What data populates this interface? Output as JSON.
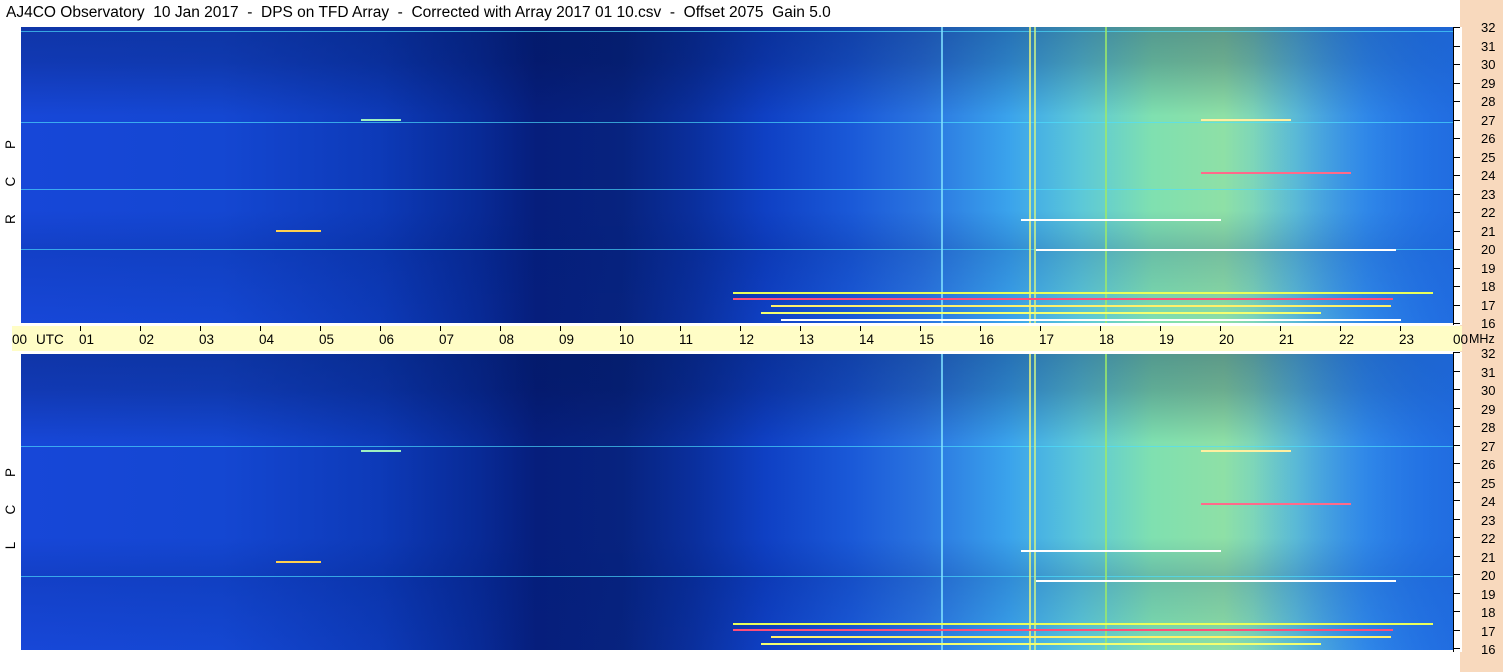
{
  "title": "AJ4CO Observatory  10 Jan 2017  -  DPS on TFD Array  -  Corrected with Array 2017 01 10.csv  -  Offset 2075  Gain 5.0",
  "panels": {
    "top": {
      "label": "R C P"
    },
    "bottom": {
      "label": "L C P"
    }
  },
  "time_axis": {
    "start_label": "00",
    "utc_label": "UTC",
    "hours": [
      "01",
      "02",
      "03",
      "04",
      "05",
      "06",
      "07",
      "08",
      "09",
      "10",
      "11",
      "12",
      "13",
      "14",
      "15",
      "16",
      "17",
      "18",
      "19",
      "20",
      "21",
      "22",
      "23"
    ],
    "end_label": "00",
    "unit_label": "MHz"
  },
  "freq_axis": {
    "labels": [
      "32",
      "31",
      "30",
      "29",
      "28",
      "27",
      "26",
      "25",
      "24",
      "23",
      "22",
      "21",
      "20",
      "19",
      "18",
      "17",
      "16"
    ]
  },
  "colors": {
    "background": "#ffffff",
    "time_bar": "#fffdc6",
    "right_strip": "#f8d9bd",
    "spectrogram_low": "#061e7c",
    "spectrogram_high": "#8ee0a6"
  }
}
